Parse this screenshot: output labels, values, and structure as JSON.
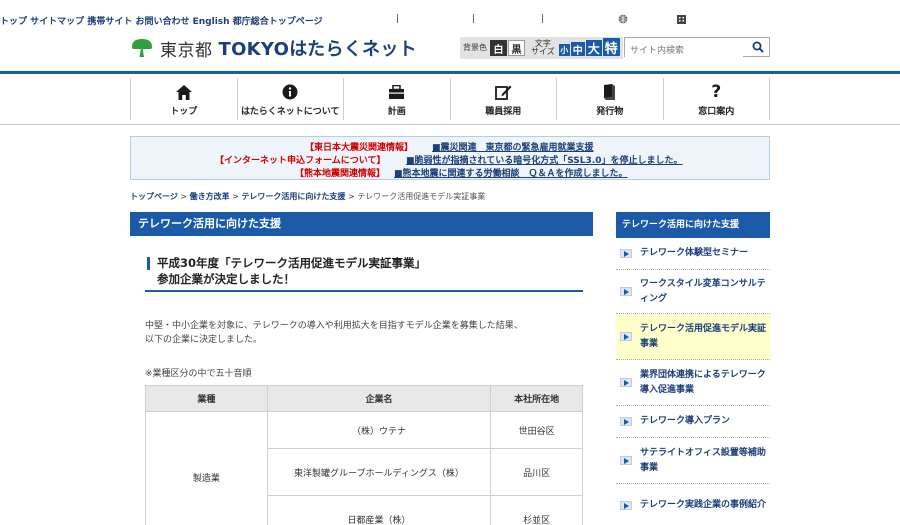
{
  "utility_links": [
    "トップ",
    "サイトマップ",
    "携帯サイト",
    "お問い合わせ",
    "English",
    "都庁総合トップページ"
  ],
  "logo": {
    "jp": "東京都",
    "en": "TOKYOはたらくネット"
  },
  "controls": {
    "bg_label": "背景色",
    "white": "白",
    "black": "黒",
    "size_label_1": "文字",
    "size_label_2": "サイズ",
    "small": "小",
    "medium": "中",
    "large": "大",
    "xlarge": "特"
  },
  "search": {
    "placeholder": "サイト内検索"
  },
  "nav": [
    {
      "label": "トップ",
      "icon": "home-icon"
    },
    {
      "label": "はたらくネットについて",
      "icon": "info-icon"
    },
    {
      "label": "計画",
      "icon": "plan-icon"
    },
    {
      "label": "職員採用",
      "icon": "edit-icon"
    },
    {
      "label": "発行物",
      "icon": "book-icon"
    },
    {
      "label": "窓口案内",
      "icon": "question-icon"
    }
  ],
  "notices": [
    {
      "tag": "【東日本大震災関連情報】",
      "link": "■震災関連　東京都の緊急雇用就業支援"
    },
    {
      "tag": "【インターネット申込フォームについて】",
      "link": "■脆弱性が指摘されている暗号化方式「SSL3.0」を停止しました。"
    },
    {
      "tag": "【熊本地震関連情報】",
      "link": "■熊本地震に関連する労働相談　Ｑ＆Ａを作成しました。"
    }
  ],
  "breadcrumb": [
    "トップページ",
    "働き方改革",
    "テレワーク活用に向けた支援",
    "テレワーク活用促進モデル実証事業"
  ],
  "main": {
    "heading": "テレワーク活用に向けた支援",
    "subheading_1": "平成30年度「テレワーク活用促進モデル実証事業」",
    "subheading_2": "参加企業が決定しました！",
    "para_1": "中堅・中小企業を対象に、テレワークの導入や利用拡大を目指すモデル企業を募集した結果、",
    "para_2": "以下の企業に決定しました。",
    "note": "※業種区分の中で五十音順"
  },
  "table": {
    "headers": [
      "業種",
      "企業名",
      "本社所在地"
    ],
    "category": "製造業",
    "rows": [
      [
        "（株）ウテナ",
        "世田谷区"
      ],
      [
        "東洋製罐グループホールディングス（株）",
        "品川区"
      ],
      [
        "日都産業（株）",
        "杉並区"
      ]
    ]
  },
  "sidebar": {
    "heading": "テレワーク活用に向けた支援",
    "items": [
      {
        "label": "テレワーク体験型セミナー",
        "active": false
      },
      {
        "label": "ワークスタイル変革コンサルティング",
        "active": false
      },
      {
        "label": "テレワーク活用促進モデル実証事業",
        "active": true
      },
      {
        "label": "業界団体連携によるテレワーク導入促進事業",
        "active": false
      },
      {
        "label": "テレワーク導入プラン",
        "active": false
      },
      {
        "label": "サテライトオフィス設置等補助事業",
        "active": false
      },
      {
        "label": "テレワーク実践企業の事例紹介",
        "active": false
      }
    ]
  },
  "colors": {
    "brand_blue": "#1b5aa6",
    "nav_text": "#1b3f78",
    "notice_red": "#d10000",
    "active_bg": "#ffffcc",
    "logo_green": "#2e9e3e"
  }
}
